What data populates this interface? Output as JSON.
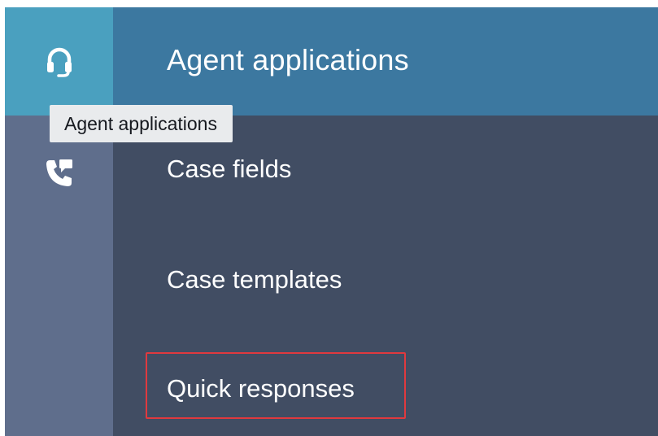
{
  "rail": {
    "items": [
      {
        "icon": "headset-icon",
        "active": true
      },
      {
        "icon": "phone-transfer-icon",
        "active": false
      }
    ]
  },
  "tooltip": {
    "text": "Agent applications"
  },
  "panel": {
    "title": "Agent applications",
    "items": [
      {
        "label": "Case fields"
      },
      {
        "label": "Case templates"
      },
      {
        "label": "Quick responses",
        "highlighted": true
      }
    ]
  },
  "colors": {
    "rail_bg": "#5f6e8c",
    "rail_active": "#4aa0bf",
    "panel_bg": "#414d63",
    "header_bg": "#3c78a0",
    "highlight": "#e0393e",
    "tooltip_bg": "#e9ebed"
  }
}
